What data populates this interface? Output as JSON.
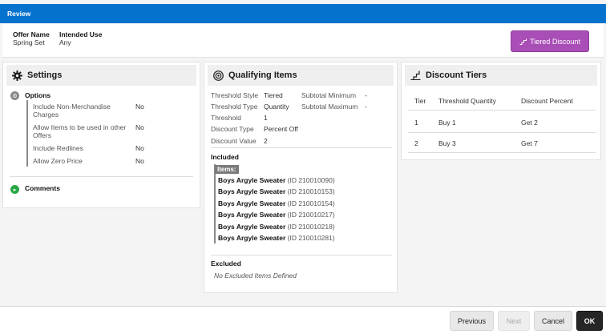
{
  "topbar": {
    "title": "Review"
  },
  "header": {
    "offer_name_label": "Offer Name",
    "offer_name_value": "Spring Set",
    "intended_use_label": "Intended Use",
    "intended_use_value": "Any",
    "tiered_button_label": "Tiered Discount"
  },
  "settings": {
    "title": "Settings",
    "options_label": "Options",
    "options": [
      {
        "label": "Include Non-Merchandise Charges",
        "value": "No"
      },
      {
        "label": "Allow Items to be used in other Offers",
        "value": "No"
      },
      {
        "label": "Include Redlines",
        "value": "No"
      },
      {
        "label": "Allow Zero Price",
        "value": "No"
      }
    ],
    "comments_label": "Comments"
  },
  "qualifying": {
    "title": "Qualifying Items",
    "left_fields": [
      {
        "label": "Threshold Style",
        "value": "Tiered"
      },
      {
        "label": "Threshold Type",
        "value": "Quantity"
      },
      {
        "label": "Threshold",
        "value": "1"
      },
      {
        "label": "Discount Type",
        "value": "Percent Off"
      },
      {
        "label": "Discount Value",
        "value": "2"
      }
    ],
    "right_fields": [
      {
        "label": "Subtotal Minimum",
        "value": "-"
      },
      {
        "label": "Subtotal Maximum",
        "value": "-"
      }
    ],
    "included_label": "Included",
    "items_tag": "Items:",
    "items": [
      {
        "name": "Boys Argyle Sweater",
        "id": "(ID 210010090)"
      },
      {
        "name": "Boys Argyle Sweater",
        "id": "(ID 210010153)"
      },
      {
        "name": "Boys Argyle Sweater",
        "id": "(ID 210010154)"
      },
      {
        "name": "Boys Argyle Sweater",
        "id": "(ID 210010217)"
      },
      {
        "name": "Boys Argyle Sweater",
        "id": "(ID 210010218)"
      },
      {
        "name": "Boys Argyle Sweater",
        "id": "(ID 210010281)"
      }
    ],
    "excluded_label": "Excluded",
    "excluded_empty": "No Excluded Items Defined"
  },
  "tiers": {
    "title": "Discount Tiers",
    "headers": [
      "Tier",
      "Threshold Quantity",
      "Discount Percent"
    ],
    "rows": [
      {
        "tier": "1",
        "threshold_prefix": "Buy",
        "threshold_value": "1",
        "discount_prefix": "Get",
        "discount_value": "2"
      },
      {
        "tier": "2",
        "threshold_prefix": "Buy",
        "threshold_value": "3",
        "discount_prefix": "Get",
        "discount_value": "7"
      }
    ]
  },
  "footer": {
    "previous": "Previous",
    "next": "Next",
    "cancel": "Cancel",
    "ok": "OK"
  },
  "colors": {
    "topbar": "#0572ce",
    "tiered_button": "#a94eb6",
    "ok_button": "#262626"
  }
}
